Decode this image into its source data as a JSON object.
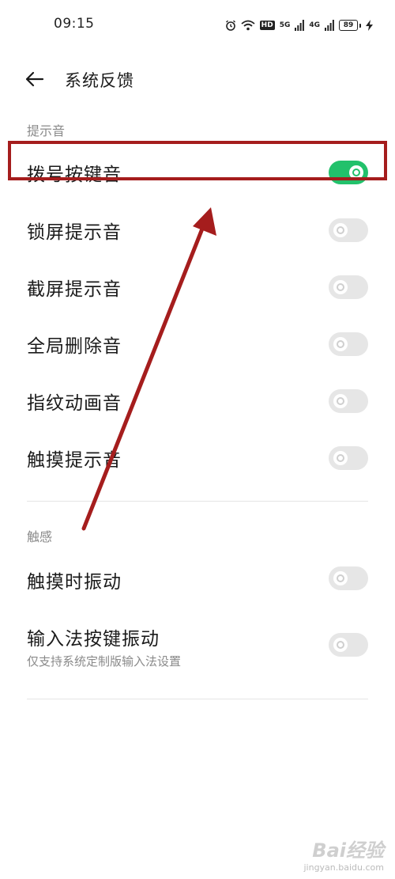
{
  "status_bar": {
    "time": "09:15",
    "network_1": "5G",
    "network_2": "4G",
    "hd_badge": "HD",
    "battery_level": "89"
  },
  "header": {
    "title": "系统反馈"
  },
  "sections": [
    {
      "label": "提示音",
      "items": [
        {
          "label": "拨号按键音",
          "enabled": true
        },
        {
          "label": "锁屏提示音",
          "enabled": false
        },
        {
          "label": "截屏提示音",
          "enabled": false
        },
        {
          "label": "全局删除音",
          "enabled": false
        },
        {
          "label": "指纹动画音",
          "enabled": false
        },
        {
          "label": "触摸提示音",
          "enabled": false
        }
      ]
    },
    {
      "label": "触感",
      "items": [
        {
          "label": "触摸时振动",
          "enabled": false
        },
        {
          "label": "输入法按键振动",
          "sublabel": "仅支持系统定制版输入法设置",
          "enabled": false
        }
      ]
    }
  ],
  "colors": {
    "toggle_on": "#22c16b",
    "toggle_off": "#e6e6e6",
    "annotation": "#a51d1d"
  },
  "watermark": {
    "main": "Bai经验",
    "sub": "jingyan.baidu.com"
  }
}
